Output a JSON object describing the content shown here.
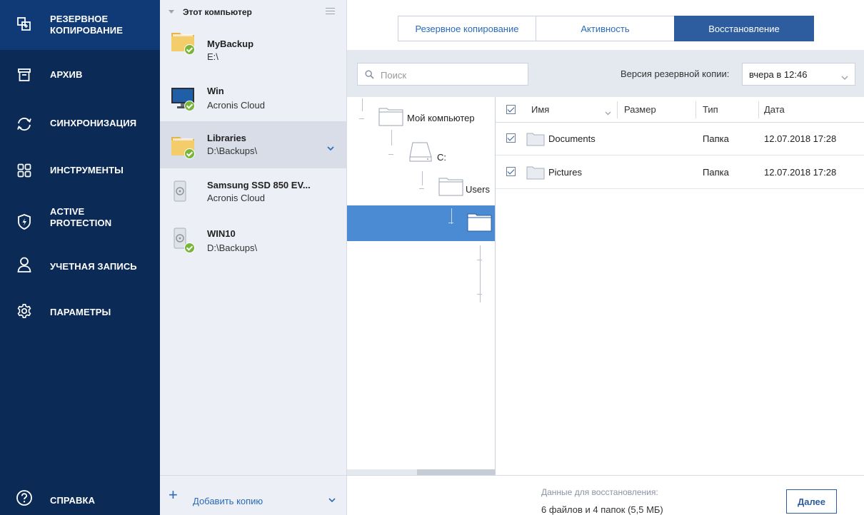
{
  "nav": {
    "items": [
      {
        "label": "Резервное\nкопирование",
        "icon": "copy-icon"
      },
      {
        "label": "Архив",
        "icon": "archive-box-icon"
      },
      {
        "label": "Синхронизация",
        "icon": "sync-icon"
      },
      {
        "label": "Инструменты",
        "icon": "grid-icon"
      },
      {
        "label": "Active\nProtection",
        "icon": "shield-bolt-icon"
      },
      {
        "label": "Учетная запись",
        "icon": "user-icon"
      },
      {
        "label": "Параметры",
        "icon": "gear-icon"
      }
    ],
    "help": {
      "label": "Справка",
      "icon": "help-circle-icon"
    }
  },
  "sources": {
    "header": "Этот компьютер",
    "items": [
      {
        "name": "MyBackup",
        "location": "E:\\",
        "icon": "folder-icon"
      },
      {
        "name": "Win",
        "location": "Acronis Cloud",
        "icon": "monitor-icon"
      },
      {
        "name": "Libraries",
        "location": "D:\\Backups\\",
        "icon": "folder-icon"
      },
      {
        "name": "Samsung SSD 850 EV...",
        "location": "Acronis Cloud",
        "icon": "disk-icon"
      },
      {
        "name": "WIN10",
        "location": "D:\\Backups\\",
        "icon": "disk-icon"
      }
    ],
    "add_copy": "Добавить копию"
  },
  "tabs": [
    "Резервное копирование",
    "Активность",
    "Восстановление"
  ],
  "toolbar": {
    "search_placeholder": "Поиск",
    "version_label": "Версия резервной копии:",
    "version_value": "вчера в 12:46"
  },
  "tree": {
    "nodes": [
      "Мой компьютер",
      "C:",
      "Users",
      ""
    ]
  },
  "files": {
    "columns": [
      "Имя",
      "Размер",
      "Тип",
      "Дата"
    ],
    "rows": [
      {
        "name": "Documents",
        "size": "",
        "type": "Папка",
        "date": "12.07.2018 17:28",
        "checked": true
      },
      {
        "name": "Pictures",
        "size": "",
        "type": "Папка",
        "date": "12.07.2018 17:28",
        "checked": true
      }
    ]
  },
  "footer": {
    "label": "Данные для восстановления:",
    "summary": "6 файлов и 4 папок (5,5 МБ)",
    "next_button": "Далее"
  },
  "colors": {
    "nav_bg": "#0b2a56",
    "accent": "#2e5d9f",
    "selection": "#4a8bd4",
    "check_green": "#79b538"
  }
}
